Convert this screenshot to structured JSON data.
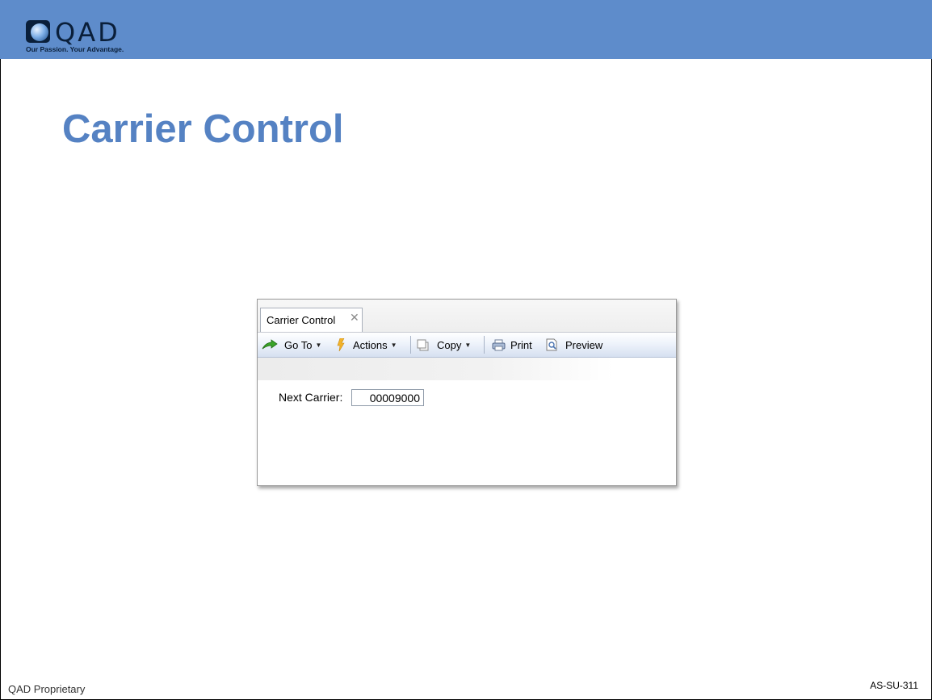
{
  "header": {
    "logo_text": "QAD",
    "tagline": "Our Passion. Your Advantage."
  },
  "page": {
    "title": "Carrier Control"
  },
  "window": {
    "tab_label": "Carrier Control",
    "tab_close_glyph": "✕",
    "toolbar": {
      "goto_label": "Go To",
      "actions_label": "Actions",
      "copy_label": "Copy",
      "print_label": "Print",
      "preview_label": "Preview"
    },
    "form": {
      "next_carrier_label": "Next Carrier:",
      "next_carrier_value": "00009000"
    }
  },
  "footer": {
    "left": "QAD Proprietary",
    "right": "AS-SU-311"
  },
  "colors": {
    "header_band": "#5e8ccb",
    "title": "#5582c3",
    "logo_dark": "#0a1f3a"
  }
}
